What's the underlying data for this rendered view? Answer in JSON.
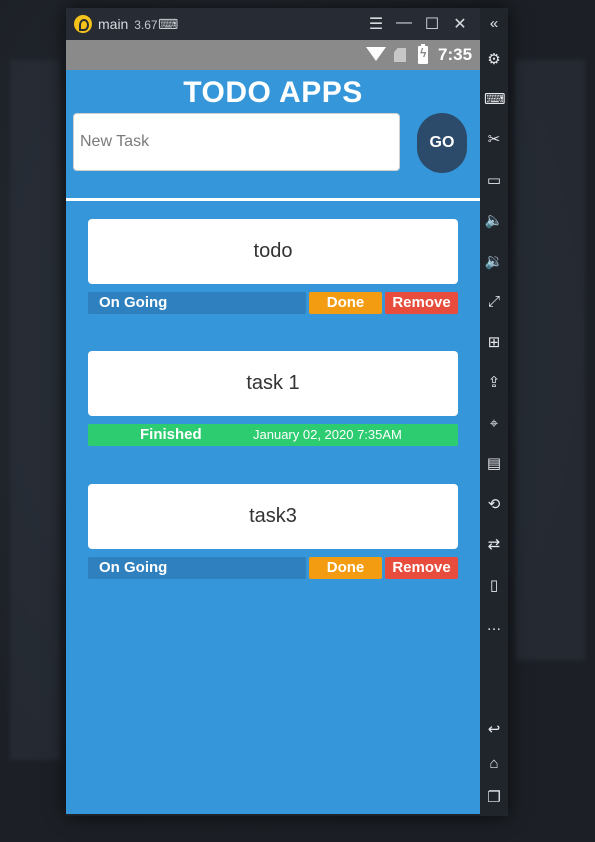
{
  "window": {
    "app_name": "main",
    "version": "3.67",
    "controls": [
      "menu-icon",
      "minimize-icon",
      "maximize-icon",
      "close-icon"
    ]
  },
  "statusbar": {
    "time": "7:35"
  },
  "app": {
    "title": "TODO APPS",
    "input_placeholder": "New Task",
    "go_label": "GO",
    "tasks": [
      {
        "name": "todo",
        "status": "On Going",
        "done_label": "Done",
        "remove_label": "Remove"
      },
      {
        "name": "task 1",
        "status": "Finished",
        "finished_at": "January 02, 2020 7:35AM"
      },
      {
        "name": "task3",
        "status": "On Going",
        "done_label": "Done",
        "remove_label": "Remove"
      }
    ]
  },
  "sidebar_icons": [
    "collapse-icon",
    "settings-icon",
    "keyboard-icon",
    "scissors-icon",
    "record-icon",
    "volume-up-icon",
    "volume-down-icon",
    "fullscreen-icon",
    "add-apk-icon",
    "install-apk-icon",
    "location-icon",
    "desktop-icon",
    "replay-icon",
    "sync-icon",
    "shake-icon",
    "more-icon",
    "back-icon",
    "home-icon",
    "recent-apps-icon"
  ],
  "colors": {
    "app_bg": "#3597d9",
    "ongoing": "#2e80bf",
    "done": "#f39c12",
    "remove": "#e74c3c",
    "finished": "#2ecc71",
    "go_button": "#2c4a6a"
  }
}
